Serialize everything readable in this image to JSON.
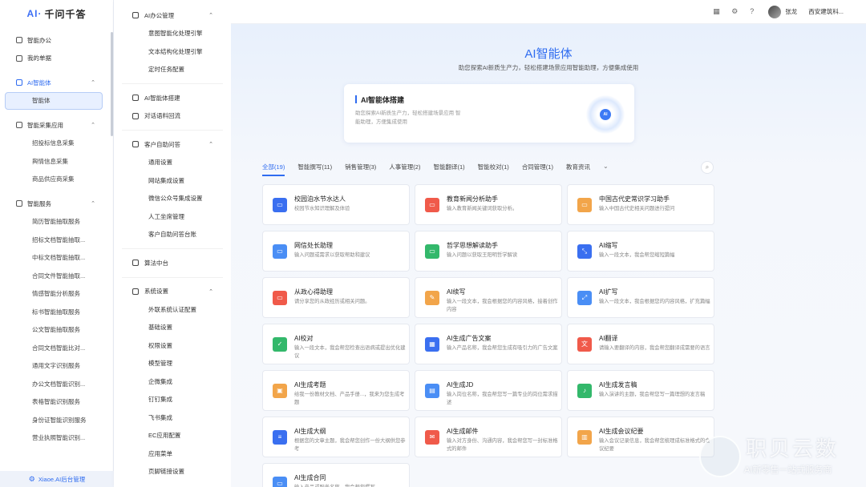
{
  "logo": {
    "ai": "AI·",
    "name": "千问千答"
  },
  "sidebar": {
    "top_items": [
      {
        "label": "智能办公",
        "icon": "home-icon"
      },
      {
        "label": "我的单据",
        "icon": "document-icon"
      }
    ],
    "groups": [
      {
        "label": "AI智能体",
        "icon": "robot-icon",
        "chevron": "⌃",
        "children": [
          "智能体"
        ]
      },
      {
        "label": "智能采集应用",
        "icon": "globe-icon",
        "chevron": "⌃",
        "children": [
          "招投标信息采集",
          "舆情信息采集",
          "商品供应商采集"
        ]
      },
      {
        "label": "智能服务",
        "icon": "service-icon",
        "chevron": "⌃",
        "children": [
          "简历智能抽取服务",
          "招标文档智能抽取...",
          "中标文档智能抽取...",
          "合同文件智能抽取...",
          "情感智能分析服务",
          "标书智能抽取服务",
          "公文智能抽取服务",
          "合同文档智能比对...",
          "通用文字识别服务",
          "办公文档智能识别...",
          "表格智能识别服务",
          "身份证智能识别服务",
          "营业执照智能识别..."
        ]
      }
    ],
    "footer": "Xiaoe.AI后台管理"
  },
  "panel": {
    "sections": [
      {
        "label": "AI办公管理",
        "icon": "office-icon",
        "chevron": "⌃",
        "items": [
          "意图智能化处理引擎",
          "文本结构化处理引擎",
          "定时任务配置"
        ]
      },
      {
        "label": "AI智能体搭建",
        "icon": "robot-icon",
        "chevron": "",
        "items": []
      },
      {
        "label": "对话语料回流",
        "icon": "chat-icon",
        "chevron": "",
        "items": []
      },
      {
        "label": "客户自助问答",
        "icon": "user-icon",
        "chevron": "⌃",
        "items": [
          "通用设置",
          "网站集成设置",
          "微信公众号集成设置",
          "人工坐席管理",
          "客户自助问答台账"
        ]
      },
      {
        "label": "算法中台",
        "icon": "monitor-icon",
        "chevron": "",
        "items": []
      },
      {
        "label": "系统设置",
        "icon": "gear-icon",
        "chevron": "⌃",
        "items": [
          "外联系统认证配置",
          "基础设置",
          "权限设置",
          "模型管理",
          "企微集成",
          "钉钉集成",
          "飞书集成",
          "EC应用配置",
          "应用菜单",
          "页脚链接设置"
        ]
      }
    ]
  },
  "topbar": {
    "user_name": "张龙",
    "org": "西安建筑科..."
  },
  "hero": {
    "title": "AI智能体",
    "subtitle": "助您探索AI新质生产力，轻松搭建场景应用智能助理，方便集成使用"
  },
  "build_card": {
    "title": "AI智能体搭建",
    "desc": "助您探索AI新质生产力，轻松搭建场景应用 智能助理，方便集成使用",
    "orb_label": "AI"
  },
  "tabs": [
    {
      "label": "全部(19)",
      "active": true
    },
    {
      "label": "智能撰写(11)"
    },
    {
      "label": "销售管理(3)"
    },
    {
      "label": "人事管理(2)"
    },
    {
      "label": "智能翻译(1)"
    },
    {
      "label": "智能校对(1)"
    },
    {
      "label": "合同管理(1)"
    },
    {
      "label": "教育资讯"
    }
  ],
  "tabs_more": "⌄",
  "cards": [
    {
      "name": "校园泊水节水达人",
      "desc": "校园节水知识理解及体验",
      "color": "#3a6ff0",
      "icon": "chat-icon",
      "glyph": "▭"
    },
    {
      "name": "教育新闻分析助手",
      "desc": "输入教育新闻关键词获取分析。",
      "color": "#f05a4a",
      "icon": "news-icon",
      "glyph": "▭"
    },
    {
      "name": "中国古代史常识学习助手",
      "desc": "输入中国古代史相关问题进行提问",
      "color": "#f2a54a",
      "icon": "book-icon",
      "glyph": "▭"
    },
    {
      "name": "网信处长助理",
      "desc": "输入问题或需求以获取帮助和建议",
      "color": "#4a8ef5",
      "icon": "chat-icon",
      "glyph": "▭"
    },
    {
      "name": "哲学思想解读助手",
      "desc": "输入问题以获取王阳明哲学解读",
      "color": "#33b86b",
      "icon": "chat-icon",
      "glyph": "▭"
    },
    {
      "name": "AI缩写",
      "desc": "输入一段文本，我会帮您缩短篇幅",
      "color": "#3a6ff0",
      "icon": "shrink-icon",
      "glyph": "⤡"
    },
    {
      "name": "从政心得助理",
      "desc": "请分享您的从政经历或相关问题。",
      "color": "#f05a4a",
      "icon": "chat-icon",
      "glyph": "▭"
    },
    {
      "name": "AI续写",
      "desc": "输入一段文本，我会根据您的内容风格，接着创作内容",
      "color": "#f2a54a",
      "icon": "pen-icon",
      "glyph": "✎"
    },
    {
      "name": "AI扩写",
      "desc": "输入一段文本，我会根据您的内容风格，扩充篇幅",
      "color": "#4a8ef5",
      "icon": "expand-icon",
      "glyph": "⤢"
    },
    {
      "name": "AI校对",
      "desc": "输入一段文本，我会帮您检查出语病或提出优化建议",
      "color": "#33b86b",
      "icon": "check-icon",
      "glyph": "✓"
    },
    {
      "name": "AI生成广告文案",
      "desc": "输入产品名称，我会帮您生成有吸引力的广告文案",
      "color": "#3a6ff0",
      "icon": "ad-icon",
      "glyph": "▦"
    },
    {
      "name": "AI翻译",
      "desc": "请输入要翻译的内容，我会帮您翻译成需要的语言",
      "color": "#f05a4a",
      "icon": "translate-icon",
      "glyph": "文"
    },
    {
      "name": "AI生成考题",
      "desc": "给我一份教材文档、产品手册...，我来为您生成考题",
      "color": "#f2a54a",
      "icon": "exam-icon",
      "glyph": "▣"
    },
    {
      "name": "AI生成JD",
      "desc": "输入岗位名称，我会帮您写一篇专业的岗位需求描述",
      "color": "#4a8ef5",
      "icon": "briefcase-icon",
      "glyph": "▤"
    },
    {
      "name": "AI生成发言稿",
      "desc": "输入演讲的主题，我会帮您写一篇理想的发言稿",
      "color": "#33b86b",
      "icon": "mic-icon",
      "glyph": "♪"
    },
    {
      "name": "AI生成大纲",
      "desc": "根据您的文章主题，我会帮您创作一份大纲供您参考",
      "color": "#3a6ff0",
      "icon": "outline-icon",
      "glyph": "≡"
    },
    {
      "name": "AI生成邮件",
      "desc": "输入对方身份、沟通内容，我会帮您写一封标准格式的邮件",
      "color": "#f05a4a",
      "icon": "mail-icon",
      "glyph": "✉"
    },
    {
      "name": "AI生成会议纪要",
      "desc": "输入会议记录信息，我会帮您梳理成标准格式的会议纪要",
      "color": "#f2a54a",
      "icon": "minutes-icon",
      "glyph": "▥"
    },
    {
      "name": "AI生成合同",
      "desc": "输入产品或服务名称，我会帮您撰写",
      "color": "#4a8ef5",
      "icon": "contract-icon",
      "glyph": "▭"
    }
  ],
  "watermark": {
    "title": "职贝云数",
    "slogan": "AI新零售一站式服务商"
  }
}
